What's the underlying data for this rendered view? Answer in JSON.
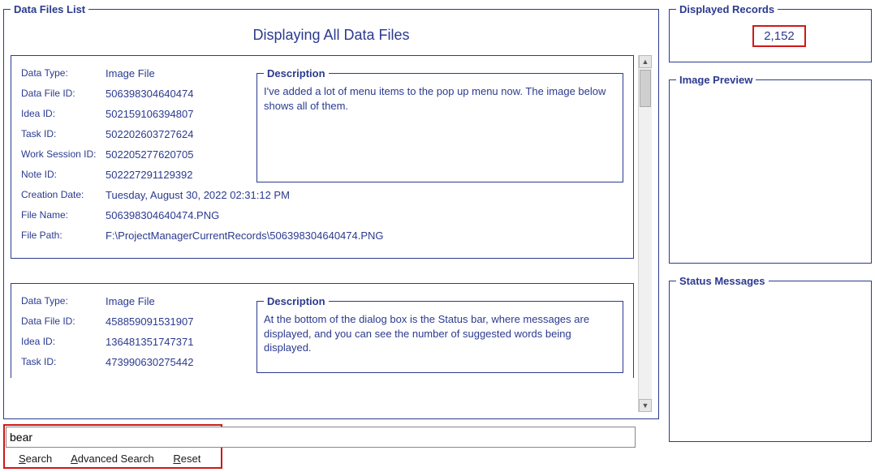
{
  "panels": {
    "data_files_list": "Data Files List",
    "displayed_records": "Displayed Records",
    "image_preview": "Image Preview",
    "status_messages": "Status Messages"
  },
  "title": "Displaying All Data Files",
  "labels": {
    "data_type": "Data Type:",
    "data_file_id": "Data File ID:",
    "idea_id": "Idea ID:",
    "task_id": "Task ID:",
    "work_session_id": "Work Session ID:",
    "note_id": "Note ID:",
    "creation_date": "Creation Date:",
    "file_name": "File Name:",
    "file_path": "File Path:",
    "description": "Description"
  },
  "records": [
    {
      "data_type": "Image File",
      "data_file_id": "506398304640474",
      "idea_id": "502159106394807",
      "task_id": "502202603727624",
      "work_session_id": "502205277620705",
      "note_id": "502227291129392",
      "creation_date": "Tuesday, August 30, 2022   02:31:12 PM",
      "file_name": "506398304640474.PNG",
      "file_path": "F:\\ProjectManagerCurrentRecords\\506398304640474.PNG",
      "description": "I've added a lot of menu items to the pop up menu now. The image below shows all of them."
    },
    {
      "data_type": "Image File",
      "data_file_id": "458859091531907",
      "idea_id": "136481351747371",
      "task_id": "473990630275442",
      "description": "At the bottom of the dialog box is the Status bar, where messages are displayed, and you can see the number of suggested words being displayed."
    }
  ],
  "search": {
    "value": "bear",
    "links": {
      "search": "Search",
      "advanced": "Advanced Search",
      "reset": "Reset"
    }
  },
  "displayed_records_value": "2,152"
}
